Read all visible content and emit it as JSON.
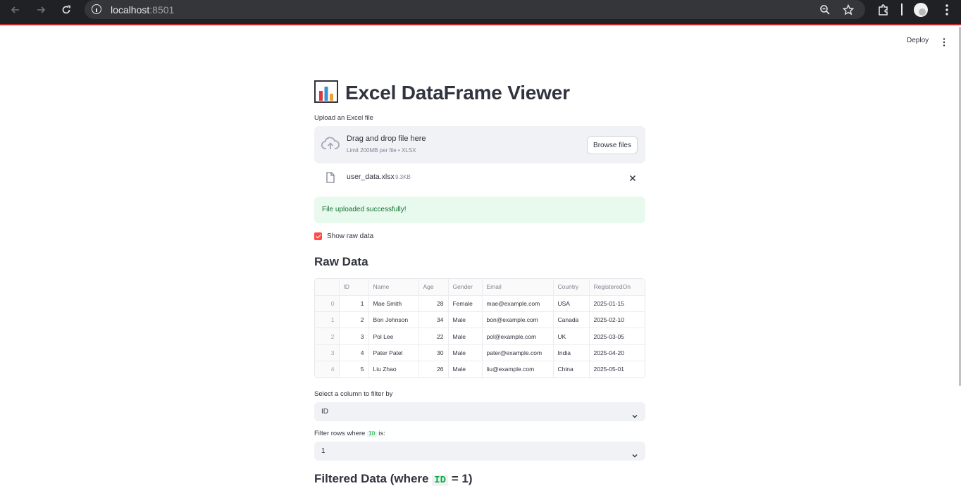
{
  "browser": {
    "url_host": "localhost",
    "url_port": ":8501"
  },
  "header": {
    "deploy_label": "Deploy"
  },
  "page": {
    "title_icon": "📊",
    "title": "Excel DataFrame Viewer"
  },
  "uploader": {
    "label": "Upload an Excel file",
    "drop_title": "Drag and drop file here",
    "drop_subtitle": "Limit 200MB per file • XLSX",
    "browse_label": "Browse files",
    "file_name": "user_data.xlsx",
    "file_size": "9.3KB"
  },
  "alert": {
    "success_text": "File uploaded successfully!",
    "color": "#177233"
  },
  "checkbox": {
    "label": "Show raw data",
    "checked": true,
    "color": "#ff4b4b"
  },
  "raw_data": {
    "heading": "Raw Data",
    "columns": [
      "",
      "ID",
      "Name",
      "Age",
      "Gender",
      "Email",
      "Country",
      "RegisteredOn"
    ],
    "rows": [
      [
        "0",
        "1",
        "Mae Smith",
        "28",
        "Female",
        "mae@example.com",
        "USA",
        "2025-01-15"
      ],
      [
        "1",
        "2",
        "Bon Johnson",
        "34",
        "Male",
        "bon@example.com",
        "Canada",
        "2025-02-10"
      ],
      [
        "2",
        "3",
        "Pol Lee",
        "22",
        "Male",
        "pol@example.com",
        "UK",
        "2025-03-05"
      ],
      [
        "3",
        "4",
        "Pater Patel",
        "30",
        "Male",
        "pater@example.com",
        "India",
        "2025-04-20"
      ],
      [
        "4",
        "5",
        "Liu Zhao",
        "26",
        "Male",
        "liu@example.com",
        "China",
        "2025-05-01"
      ]
    ]
  },
  "filter": {
    "column_label": "Select a column to filter by",
    "column_value": "ID",
    "rows_label_prefix": "Filter rows where",
    "rows_label_code": "ID",
    "rows_label_suffix": "is:",
    "rows_value": "1",
    "filtered_heading_prefix": "Filtered Data (where",
    "filtered_heading_code": "ID",
    "filtered_heading_suffix": "= 1)"
  }
}
